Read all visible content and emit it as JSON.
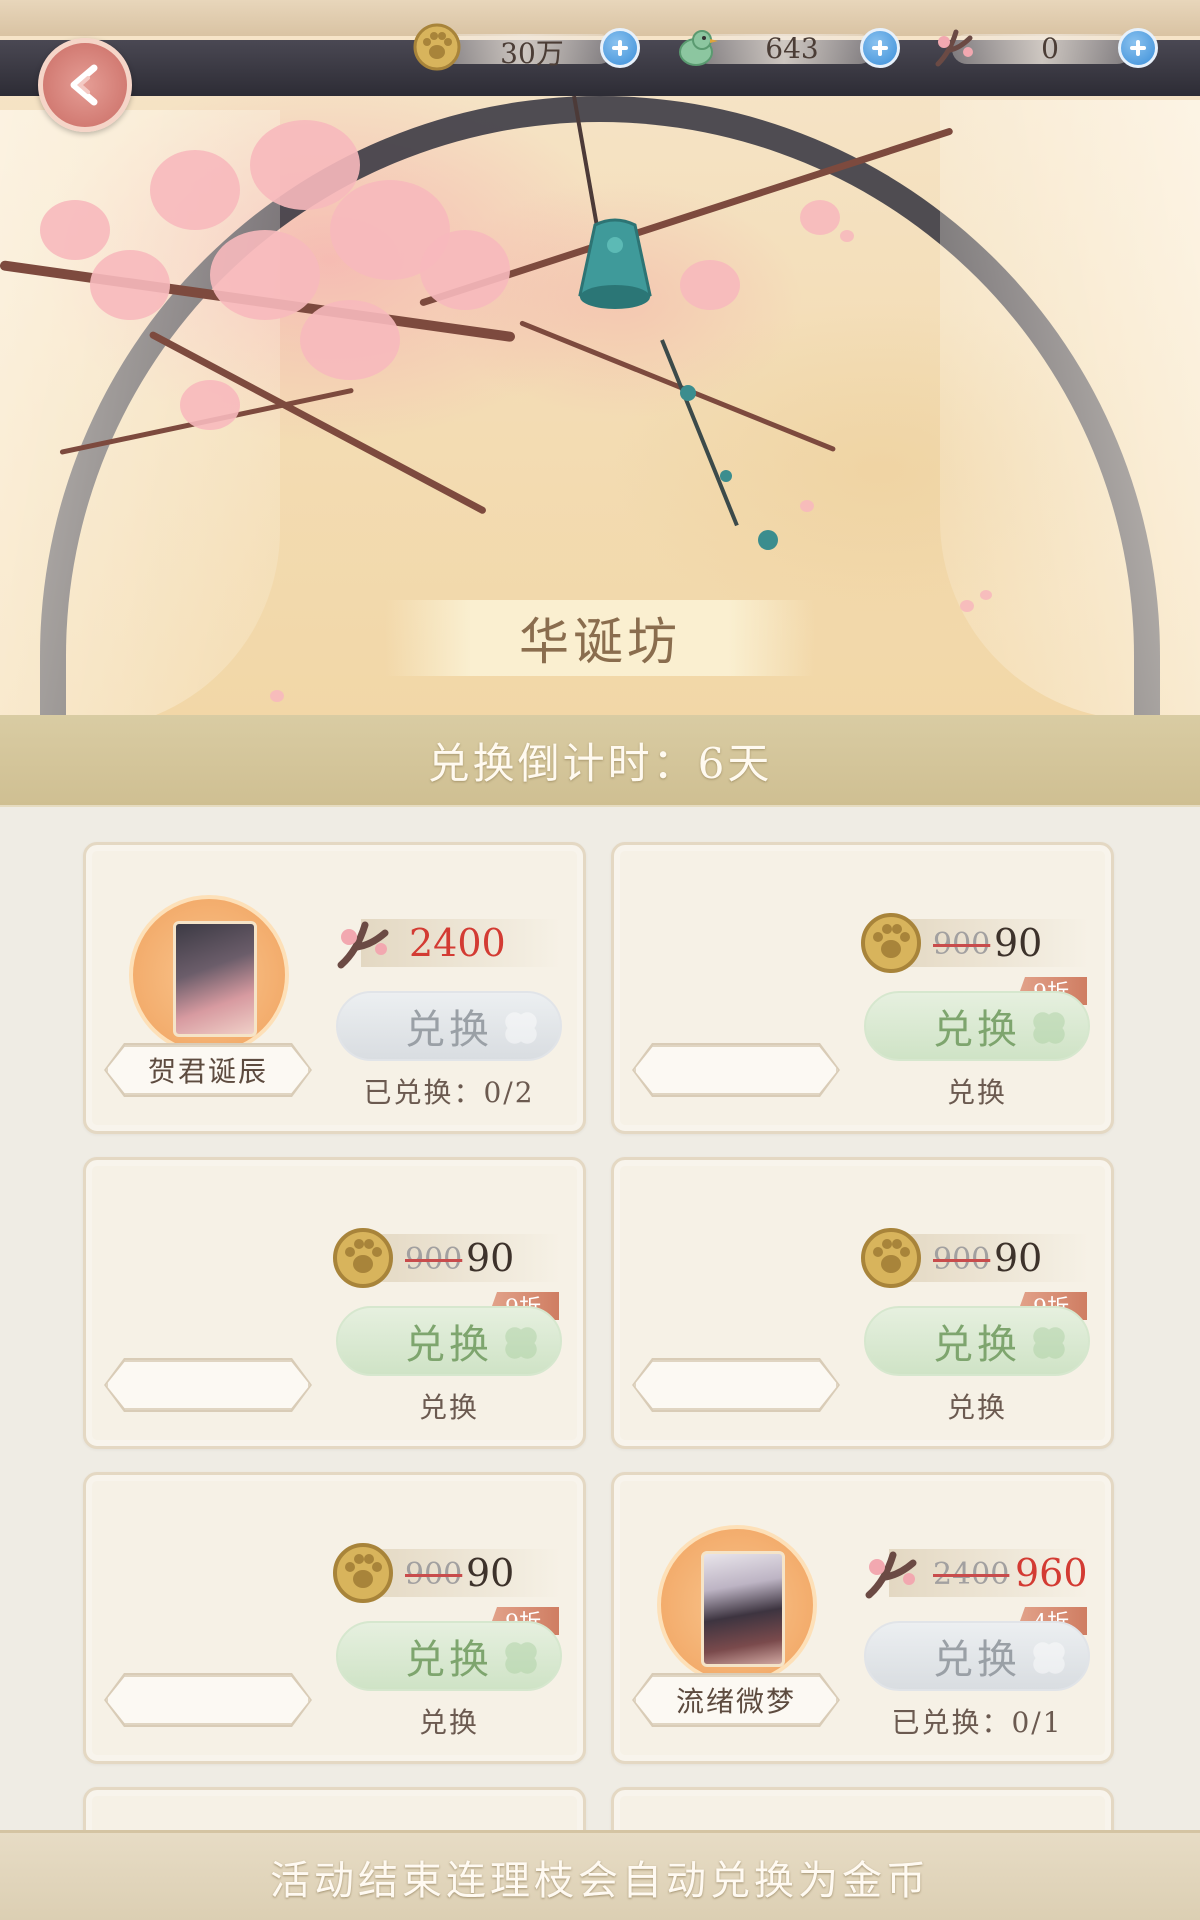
{
  "header": {
    "back_icon": "back-arrow-icon",
    "currencies": [
      {
        "icon": "paw-coin-icon",
        "value": "30万"
      },
      {
        "icon": "green-bird-icon",
        "value": "643"
      },
      {
        "icon": "lianlizhi-branch-icon",
        "value": "0"
      }
    ]
  },
  "banner": {
    "title": "华诞坊"
  },
  "countdown": {
    "text": "兑换倒计时：6天"
  },
  "cards": [
    {
      "name": "贺君诞辰",
      "has_avatar": true,
      "currency_icon": "branch-icon",
      "old_price": "",
      "price": "2400",
      "discount": "",
      "button_label": "兑换",
      "button_state": "disabled",
      "status": "已兑换：0/2"
    },
    {
      "name": "",
      "has_avatar": false,
      "currency_icon": "paw-coin-icon",
      "old_price": "900",
      "price": "90",
      "discount": "9折",
      "button_label": "兑换",
      "button_state": "active",
      "status": "兑换"
    },
    {
      "name": "",
      "has_avatar": false,
      "currency_icon": "paw-coin-icon",
      "old_price": "900",
      "price": "90",
      "discount": "9折",
      "button_label": "兑换",
      "button_state": "active",
      "status": "兑换"
    },
    {
      "name": "",
      "has_avatar": false,
      "currency_icon": "paw-coin-icon",
      "old_price": "900",
      "price": "90",
      "discount": "9折",
      "button_label": "兑换",
      "button_state": "active",
      "status": "兑换"
    },
    {
      "name": "",
      "has_avatar": false,
      "currency_icon": "paw-coin-icon",
      "old_price": "900",
      "price": "90",
      "discount": "9折",
      "button_label": "兑换",
      "button_state": "active",
      "status": "兑换"
    },
    {
      "name": "流绪微梦",
      "has_avatar": true,
      "currency_icon": "branch-icon",
      "old_price": "2400",
      "price": "960",
      "discount": "4折",
      "button_label": "兑换",
      "button_state": "disabled",
      "status": "已兑换：0/1"
    }
  ],
  "footer": {
    "notice": "活动结束连理枝会自动兑换为金币"
  },
  "colors": {
    "price_red": "#d33b33",
    "button_green": "#cfe3c6",
    "button_grey": "#d9dde1",
    "discount_tag": "#cf7d62",
    "plus_blue": "#3c8fd9"
  }
}
